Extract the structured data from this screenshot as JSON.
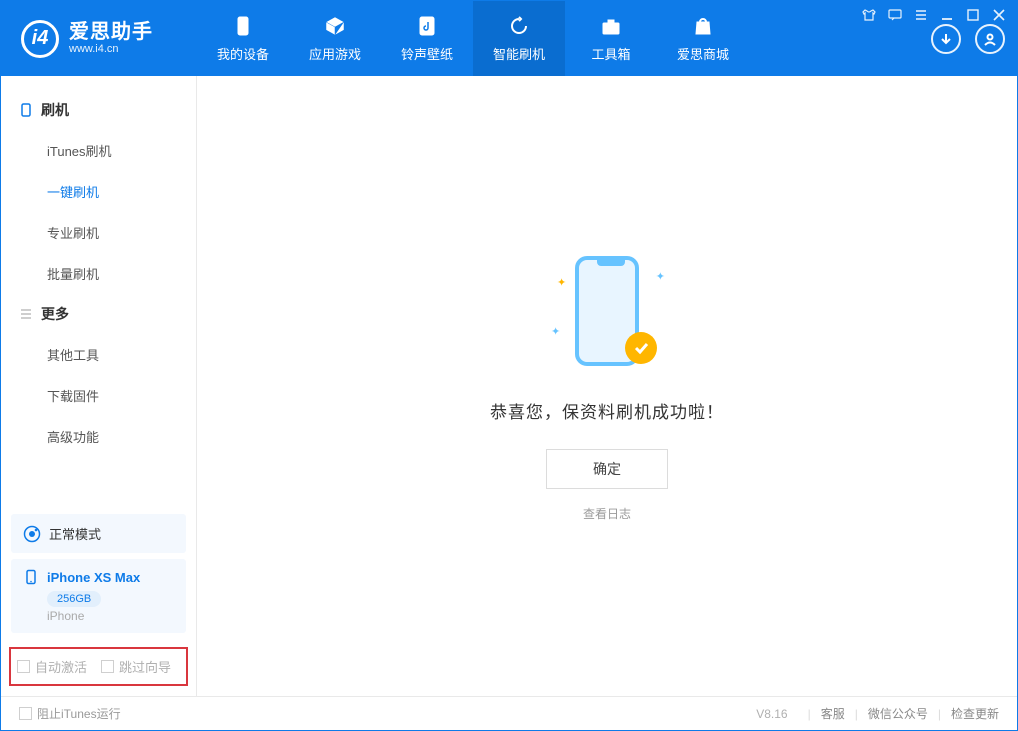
{
  "app": {
    "title": "爱思助手",
    "subtitle": "www.i4.cn"
  },
  "nav": {
    "mydevice": "我的设备",
    "apps": "应用游戏",
    "ringtone": "铃声壁纸",
    "flash": "智能刷机",
    "toolbox": "工具箱",
    "store": "爱思商城"
  },
  "sidebar": {
    "group_flash": "刷机",
    "items_flash": {
      "itunes": "iTunes刷机",
      "oneclick": "一键刷机",
      "pro": "专业刷机",
      "batch": "批量刷机"
    },
    "group_more": "更多",
    "items_more": {
      "othertools": "其他工具",
      "firmware": "下载固件",
      "advanced": "高级功能"
    },
    "status_label": "正常模式",
    "device": {
      "name": "iPhone XS Max",
      "storage": "256GB",
      "type": "iPhone"
    },
    "checks": {
      "autoactivate": "自动激活",
      "skipguide": "跳过向导"
    }
  },
  "main": {
    "success_msg": "恭喜您，保资料刷机成功啦！",
    "ok_label": "确定",
    "viewlog_label": "查看日志"
  },
  "footer": {
    "block_itunes": "阻止iTunes运行",
    "version": "V8.16",
    "support": "客服",
    "wechat": "微信公众号",
    "update": "检查更新"
  }
}
